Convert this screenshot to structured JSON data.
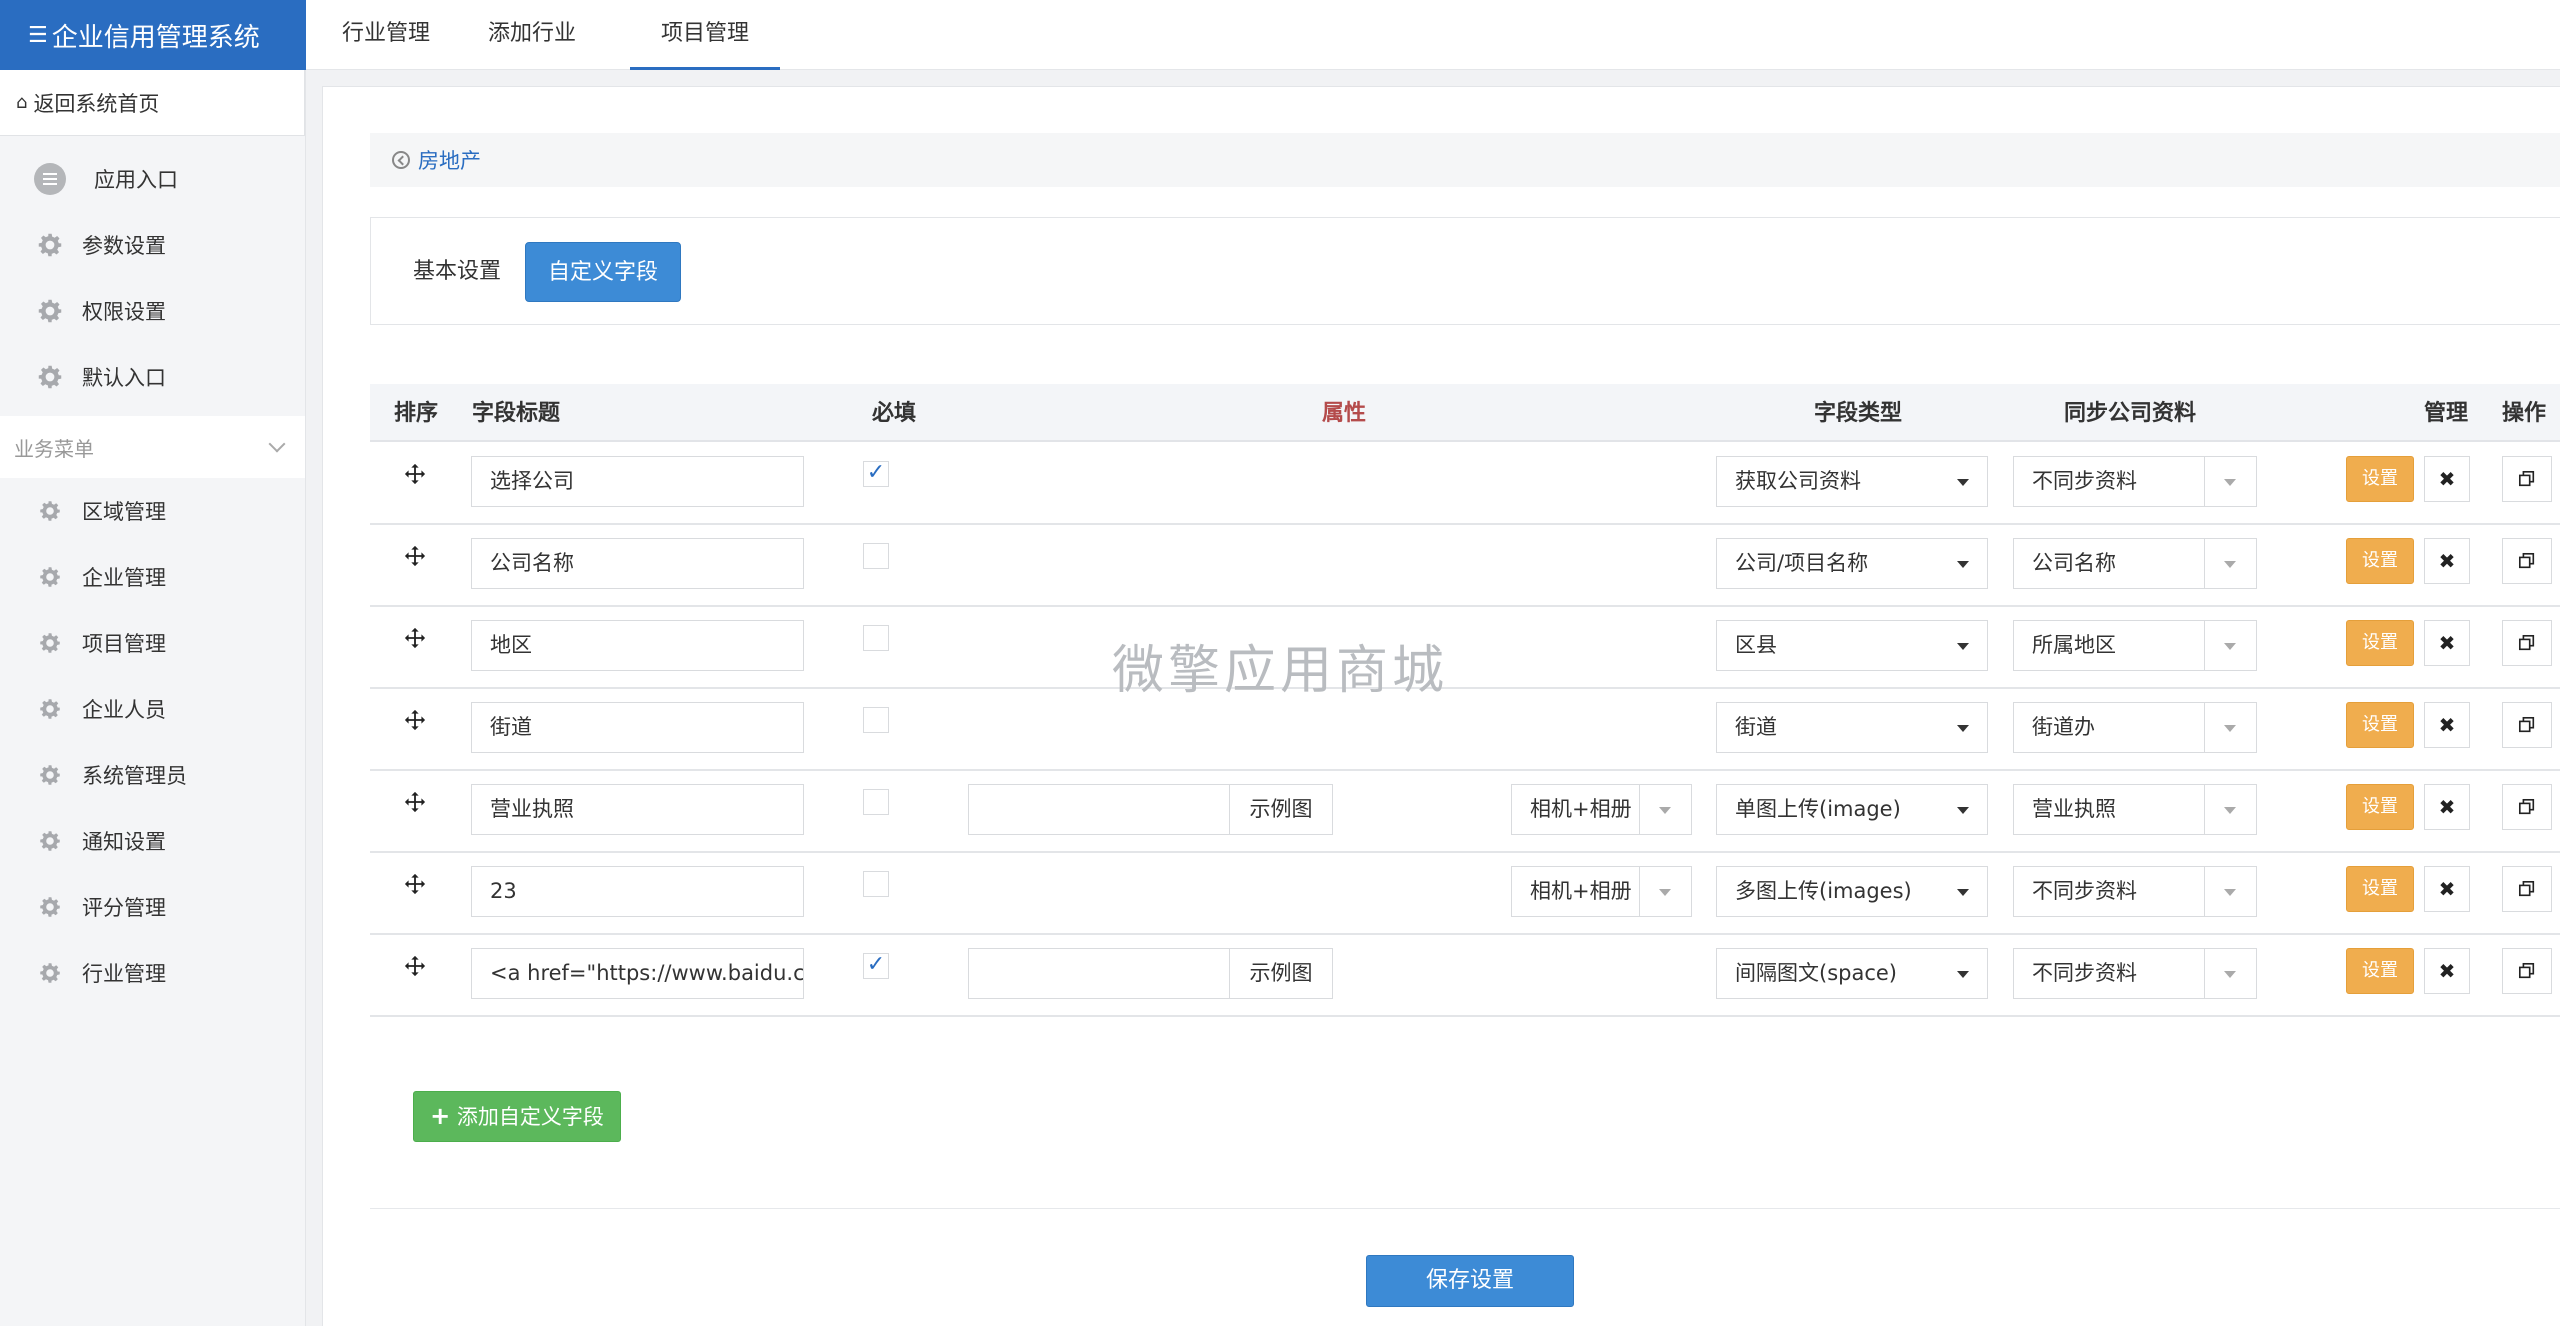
{
  "brand": {
    "icon": "menu-icon",
    "title": "企业信用管理系统"
  },
  "sidebar": {
    "home_label": "返回系统首页",
    "top_items": [
      {
        "label": "应用入口",
        "icon": "chat-icon"
      },
      {
        "label": "参数设置",
        "icon": "gear-icon"
      },
      {
        "label": "权限设置",
        "icon": "gear-icon"
      },
      {
        "label": "默认入口",
        "icon": "gear-icon"
      }
    ],
    "group_label": "业务菜单",
    "group_items": [
      {
        "label": "区域管理"
      },
      {
        "label": "企业管理"
      },
      {
        "label": "项目管理"
      },
      {
        "label": "企业人员"
      },
      {
        "label": "系统管理员"
      },
      {
        "label": "通知设置"
      },
      {
        "label": "评分管理"
      },
      {
        "label": "行业管理"
      }
    ]
  },
  "topnav": {
    "tabs": [
      "行业管理",
      "添加行业",
      "项目管理"
    ],
    "active": "项目管理"
  },
  "breadcrumb": {
    "label": "房地产"
  },
  "subtabs": {
    "basic": "基本设置",
    "custom": "自定义字段",
    "active": "自定义字段"
  },
  "table": {
    "headers": {
      "sort": "排序",
      "title": "字段标题",
      "required": "必填",
      "attr": "属性",
      "type": "字段类型",
      "sync": "同步公司资料",
      "manage": "管理",
      "ops": "操作"
    },
    "rows": [
      {
        "title": "选择公司",
        "required": true,
        "type": "获取公司资料",
        "sync": "不同步资料"
      },
      {
        "title": "公司名称",
        "required": false,
        "type": "公司/项目名称",
        "sync": "公司名称"
      },
      {
        "title": "地区",
        "required": false,
        "type": "区县",
        "sync": "所属地区"
      },
      {
        "title": "街道",
        "required": false,
        "type": "街道",
        "sync": "街道办"
      },
      {
        "title": "营业执照",
        "required": false,
        "attr_example": "示例图",
        "attr_source": "相机+相册",
        "type": "单图上传(image)",
        "sync": "营业执照"
      },
      {
        "title": "23",
        "required": false,
        "attr_source": "相机+相册",
        "type": "多图上传(images)",
        "sync": "不同步资料"
      },
      {
        "title": "<a href=\"https://www.baidu.c",
        "required": true,
        "attr_example": "示例图",
        "type": "间隔图文(space)",
        "sync": "不同步资料"
      }
    ],
    "set_label": "设置",
    "delete_label": "✖"
  },
  "watermark": "微擎应用商城",
  "actions": {
    "add_label": "添加自定义字段",
    "save_label": "保存设置"
  }
}
